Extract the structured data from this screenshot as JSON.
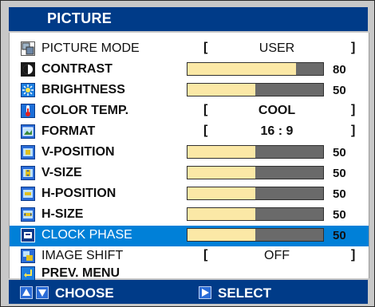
{
  "menu": {
    "title": "PICTURE",
    "items": [
      {
        "label": "PICTURE MODE",
        "option": "USER"
      },
      {
        "label": "CONTRAST",
        "value": "80",
        "level": 0.8
      },
      {
        "label": "BRIGHTNESS",
        "value": "50",
        "level": 0.5
      },
      {
        "label": "COLOR TEMP.",
        "option": "COOL"
      },
      {
        "label": "FORMAT",
        "option": "16 : 9"
      },
      {
        "label": "V-POSITION",
        "value": "50",
        "level": 0.5
      },
      {
        "label": "V-SIZE",
        "value": "50",
        "level": 0.5
      },
      {
        "label": "H-POSITION",
        "value": "50",
        "level": 0.5
      },
      {
        "label": "H-SIZE",
        "value": "50",
        "level": 0.5
      },
      {
        "label": "CLOCK PHASE",
        "value": "50",
        "level": 0.5,
        "selected": true
      },
      {
        "label": "IMAGE SHIFT",
        "option": "OFF"
      },
      {
        "label": "PREV. MENU"
      }
    ],
    "bracket_left": "[",
    "bracket_right": "]"
  },
  "footer": {
    "choose_label": "CHOOSE",
    "select_label": "SELECT"
  },
  "colors": {
    "title_bar": "#003b88",
    "selected_row": "#0080d8",
    "bar_fill": "#fbe8a6",
    "bar_track": "#6a6a6a"
  },
  "icons": [
    "picture-mode-icon",
    "contrast-icon",
    "brightness-icon",
    "color-temp-icon",
    "format-icon",
    "v-position-icon",
    "v-size-icon",
    "h-position-icon",
    "h-size-icon",
    "clock-phase-icon",
    "image-shift-icon",
    "prev-menu-icon",
    "up-arrow-icon",
    "down-arrow-icon",
    "right-arrow-icon"
  ]
}
